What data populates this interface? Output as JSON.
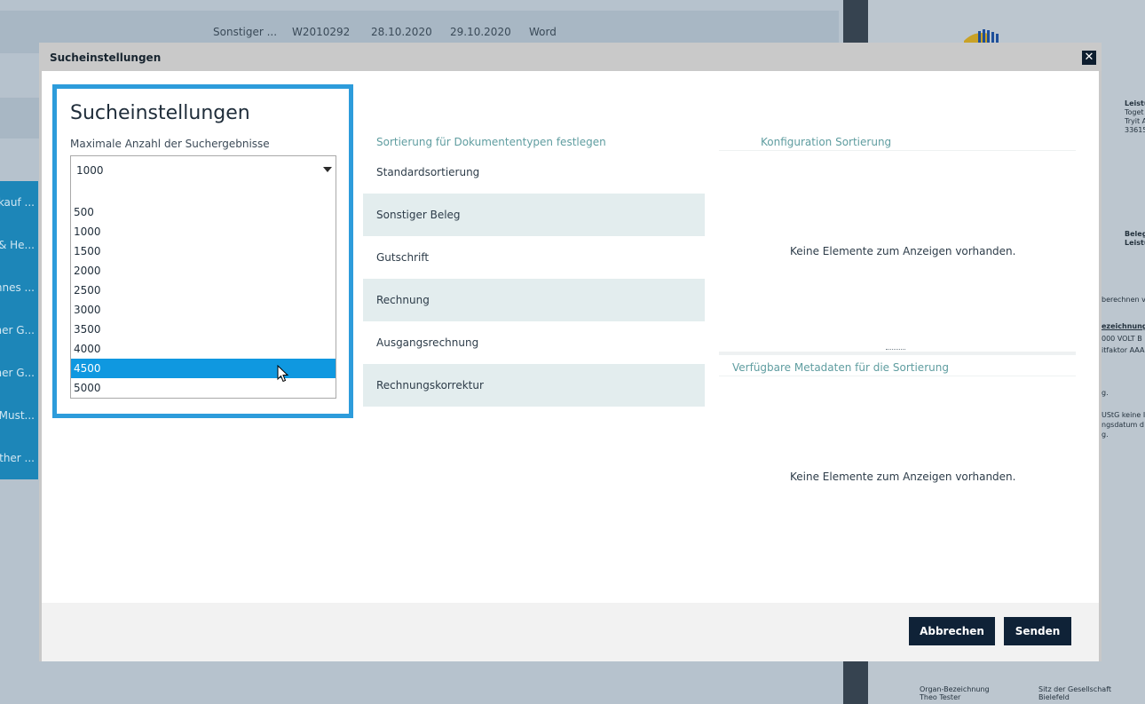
{
  "background": {
    "top_row": [
      "Sonstiger ...",
      "W2010292",
      "28.10.2020",
      "29.10.2020",
      "Word"
    ],
    "left_items": [
      "kauf ...",
      "& He...",
      "nnes ...",
      "her G...",
      "her G...",
      "Must...",
      "ther ..."
    ],
    "doc_texts": [
      "Leistu",
      "Toget",
      "Tryit A",
      "33615",
      "Beleg",
      "Leistu",
      "berechnen v",
      "ezeichnung",
      "000 VOLT B",
      "itfaktor AAA",
      "g.",
      "UStG keine I",
      "ngsdatum d",
      "g.",
      "Organ-Bezeichnung",
      "Theo Tester",
      "Sitz der Gesellschaft",
      "Bielefeld"
    ]
  },
  "dialog": {
    "title": "Sucheinstellungen",
    "close_icon": "close-icon",
    "settings": {
      "heading": "Sucheinstellungen",
      "max_results_label": "Maximale Anzahl der Suchergebnisse",
      "selected_value": "1000",
      "options": [
        "",
        "500",
        "1000",
        "1500",
        "2000",
        "2500",
        "3000",
        "3500",
        "4000",
        "4500",
        "5000"
      ],
      "highlighted_option": "4500"
    },
    "doc_sort": {
      "header": "Sortierung für Dokumententypen festlegen",
      "items": [
        "Standardsortierung",
        "Sonstiger Beleg",
        "Gutschrift",
        "Rechnung",
        "Ausgangsrechnung",
        "Rechnungskorrektur"
      ]
    },
    "config_sort": {
      "header": "Konfiguration Sortierung",
      "empty_message": "Keine Elemente zum Anzeigen vorhanden."
    },
    "metadata": {
      "header": "Verfügbare Metadaten für die Sortierung",
      "empty_message": "Keine Elemente zum Anzeigen vorhanden."
    },
    "footer": {
      "cancel_label": "Abbrechen",
      "send_label": "Senden"
    }
  },
  "colors": {
    "accent": "#2d9cdb",
    "selection": "#0f98e0",
    "button": "#0f2237",
    "section_header": "#5f9da0",
    "alt_row": "#e3edee"
  }
}
